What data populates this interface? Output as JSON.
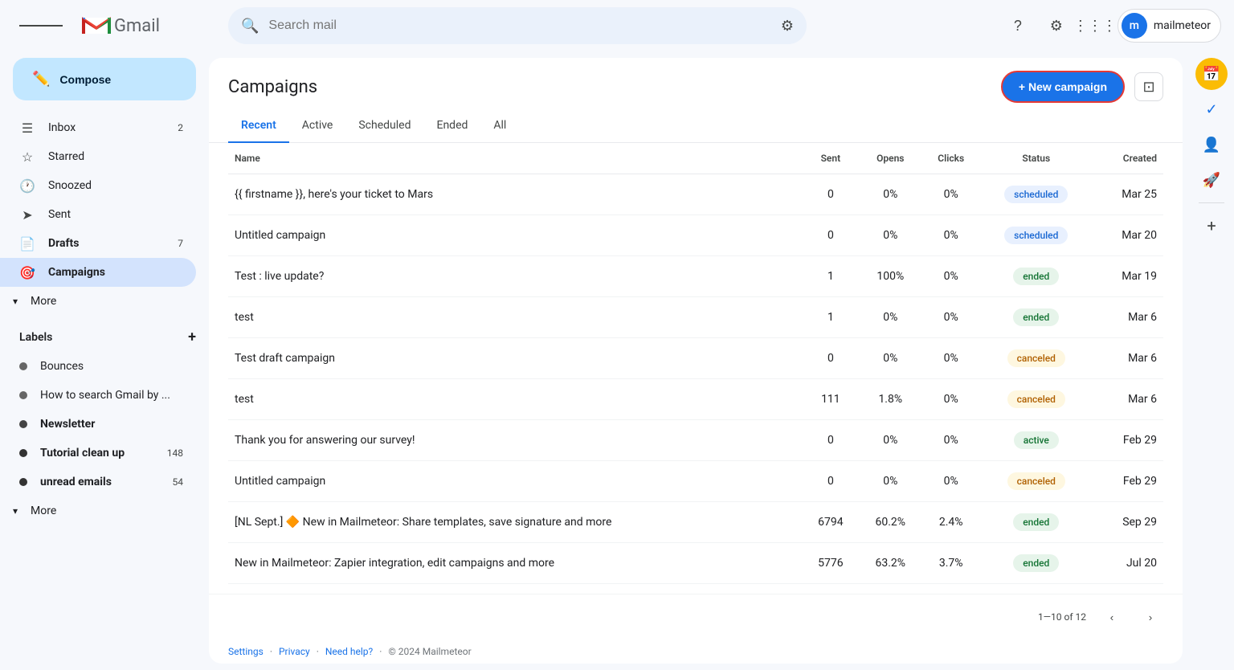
{
  "topbar": {
    "search_placeholder": "Search mail",
    "user_initial": "m",
    "user_name": "mailmeteor"
  },
  "sidebar": {
    "compose_label": "Compose",
    "nav_items": [
      {
        "id": "inbox",
        "label": "Inbox",
        "icon": "☰",
        "count": "2",
        "active": false
      },
      {
        "id": "starred",
        "label": "Starred",
        "icon": "☆",
        "count": "",
        "active": false
      },
      {
        "id": "snoozed",
        "label": "Snoozed",
        "icon": "🕐",
        "count": "",
        "active": false
      },
      {
        "id": "sent",
        "label": "Sent",
        "icon": "➤",
        "count": "",
        "active": false
      },
      {
        "id": "drafts",
        "label": "Drafts",
        "icon": "📄",
        "count": "7",
        "active": false
      },
      {
        "id": "campaigns",
        "label": "Campaigns",
        "icon": "🎯",
        "count": "",
        "active": true
      }
    ],
    "more_label": "More",
    "labels_title": "Labels",
    "labels": [
      {
        "id": "bounces",
        "label": "Bounces",
        "count": "",
        "bold": false
      },
      {
        "id": "how-to-search",
        "label": "How to search Gmail by ...",
        "count": "",
        "bold": false
      },
      {
        "id": "newsletter",
        "label": "Newsletter",
        "count": "",
        "bold": true
      },
      {
        "id": "tutorial-cleanup",
        "label": "Tutorial clean up",
        "count": "148",
        "bold": true
      },
      {
        "id": "unread-emails",
        "label": "unread emails",
        "count": "54",
        "bold": true
      }
    ],
    "labels_more": "More"
  },
  "page": {
    "title": "Campaigns",
    "new_campaign_btn": "+ New campaign"
  },
  "tabs": [
    {
      "id": "recent",
      "label": "Recent",
      "active": true
    },
    {
      "id": "active",
      "label": "Active",
      "active": false
    },
    {
      "id": "scheduled",
      "label": "Scheduled",
      "active": false
    },
    {
      "id": "ended",
      "label": "Ended",
      "active": false
    },
    {
      "id": "all",
      "label": "All",
      "active": false
    }
  ],
  "table": {
    "columns": [
      {
        "id": "name",
        "label": "Name"
      },
      {
        "id": "sent",
        "label": "Sent"
      },
      {
        "id": "opens",
        "label": "Opens"
      },
      {
        "id": "clicks",
        "label": "Clicks"
      },
      {
        "id": "status",
        "label": "Status"
      },
      {
        "id": "created",
        "label": "Created"
      }
    ],
    "rows": [
      {
        "name": "{{ firstname }}, here's your ticket to Mars",
        "sent": "0",
        "opens": "0%",
        "clicks": "0%",
        "status": "scheduled",
        "created": "Mar 25"
      },
      {
        "name": "Untitled campaign",
        "sent": "0",
        "opens": "0%",
        "clicks": "0%",
        "status": "scheduled",
        "created": "Mar 20"
      },
      {
        "name": "Test : live update?",
        "sent": "1",
        "opens": "100%",
        "clicks": "0%",
        "status": "ended",
        "created": "Mar 19"
      },
      {
        "name": "test",
        "sent": "1",
        "opens": "0%",
        "clicks": "0%",
        "status": "ended",
        "created": "Mar 6"
      },
      {
        "name": "Test draft campaign",
        "sent": "0",
        "opens": "0%",
        "clicks": "0%",
        "status": "canceled",
        "created": "Mar 6"
      },
      {
        "name": "test",
        "sent": "111",
        "opens": "1.8%",
        "clicks": "0%",
        "status": "canceled",
        "created": "Mar 6"
      },
      {
        "name": "Thank you for answering our survey!",
        "sent": "0",
        "opens": "0%",
        "clicks": "0%",
        "status": "active",
        "created": "Feb 29"
      },
      {
        "name": "Untitled campaign",
        "sent": "0",
        "opens": "0%",
        "clicks": "0%",
        "status": "canceled",
        "created": "Feb 29"
      },
      {
        "name": "[NL Sept.] 🔶 New in Mailmeteor: Share templates, save signature and more",
        "sent": "6794",
        "opens": "60.2%",
        "clicks": "2.4%",
        "status": "ended",
        "created": "Sep 29"
      },
      {
        "name": "New in Mailmeteor: Zapier integration, edit campaigns and more",
        "sent": "5776",
        "opens": "63.2%",
        "clicks": "3.7%",
        "status": "ended",
        "created": "Jul 20"
      }
    ]
  },
  "pagination": {
    "text": "1—10 of 12"
  },
  "footer": {
    "settings": "Settings",
    "privacy": "Privacy",
    "need_help": "Need help?",
    "copyright": "© 2024 Mailmeteor"
  }
}
